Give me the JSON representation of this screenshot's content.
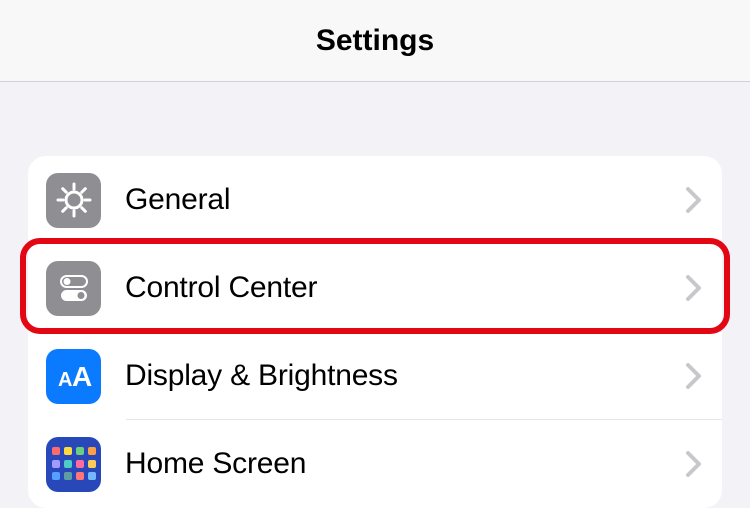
{
  "header": {
    "title": "Settings"
  },
  "rows": [
    {
      "label": "General",
      "icon": "gear",
      "bg": "gray"
    },
    {
      "label": "Control Center",
      "icon": "toggles",
      "bg": "gray",
      "highlighted": true
    },
    {
      "label": "Display & Brightness",
      "icon": "aa-text",
      "bg": "blue"
    },
    {
      "label": "Home Screen",
      "icon": "app-grid",
      "bg": "darkblue"
    }
  ]
}
